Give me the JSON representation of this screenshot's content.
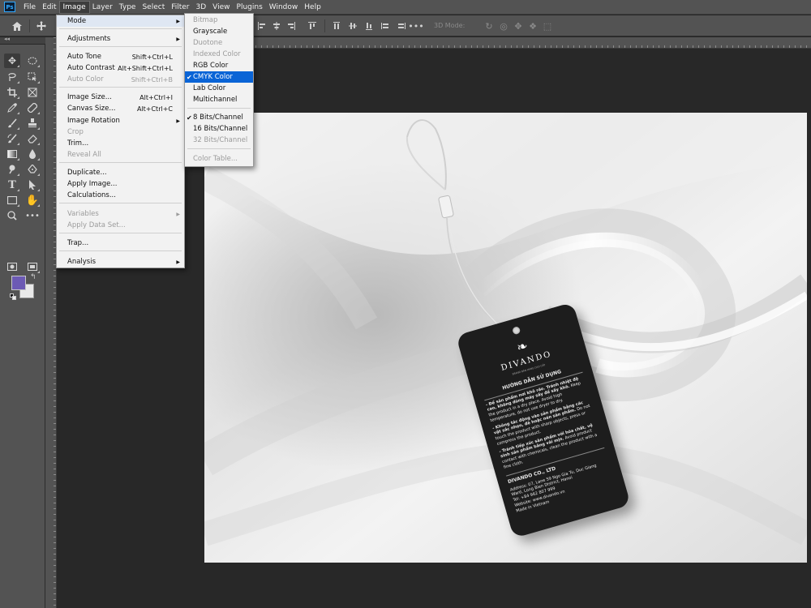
{
  "menubar": {
    "logo": "Ps",
    "items": [
      "File",
      "Edit",
      "Image",
      "Layer",
      "Type",
      "Select",
      "Filter",
      "3D",
      "View",
      "Plugins",
      "Window",
      "Help"
    ],
    "active": "Image"
  },
  "options_bar": {
    "mode_3d_label": "3D Mode:"
  },
  "image_menu": {
    "items": [
      {
        "label": "Mode",
        "shortcut": "",
        "submenu": true,
        "disabled": false
      },
      {
        "label": "Adjustments",
        "shortcut": "",
        "submenu": true,
        "disabled": false
      },
      {
        "label": "Auto Tone",
        "shortcut": "Shift+Ctrl+L",
        "submenu": false,
        "disabled": false
      },
      {
        "label": "Auto Contrast",
        "shortcut": "Alt+Shift+Ctrl+L",
        "submenu": false,
        "disabled": false
      },
      {
        "label": "Auto Color",
        "shortcut": "Shift+Ctrl+B",
        "submenu": false,
        "disabled": true
      },
      {
        "label": "Image Size...",
        "shortcut": "Alt+Ctrl+I",
        "submenu": false,
        "disabled": false
      },
      {
        "label": "Canvas Size...",
        "shortcut": "Alt+Ctrl+C",
        "submenu": false,
        "disabled": false
      },
      {
        "label": "Image Rotation",
        "shortcut": "",
        "submenu": true,
        "disabled": false
      },
      {
        "label": "Crop",
        "shortcut": "",
        "submenu": false,
        "disabled": true
      },
      {
        "label": "Trim...",
        "shortcut": "",
        "submenu": false,
        "disabled": false
      },
      {
        "label": "Reveal All",
        "shortcut": "",
        "submenu": false,
        "disabled": true
      },
      {
        "label": "Duplicate...",
        "shortcut": "",
        "submenu": false,
        "disabled": false
      },
      {
        "label": "Apply Image...",
        "shortcut": "",
        "submenu": false,
        "disabled": false
      },
      {
        "label": "Calculations...",
        "shortcut": "",
        "submenu": false,
        "disabled": false
      },
      {
        "label": "Variables",
        "shortcut": "",
        "submenu": true,
        "disabled": true
      },
      {
        "label": "Apply Data Set...",
        "shortcut": "",
        "submenu": false,
        "disabled": true
      },
      {
        "label": "Trap...",
        "shortcut": "",
        "submenu": false,
        "disabled": false
      },
      {
        "label": "Analysis",
        "shortcut": "",
        "submenu": true,
        "disabled": false
      }
    ]
  },
  "mode_menu": {
    "items": [
      {
        "label": "Bitmap",
        "disabled": true,
        "checked": false,
        "selected": false
      },
      {
        "label": "Grayscale",
        "disabled": false,
        "checked": false,
        "selected": false
      },
      {
        "label": "Duotone",
        "disabled": true,
        "checked": false,
        "selected": false
      },
      {
        "label": "Indexed Color",
        "disabled": true,
        "checked": false,
        "selected": false
      },
      {
        "label": "RGB Color",
        "disabled": false,
        "checked": false,
        "selected": false
      },
      {
        "label": "CMYK Color",
        "disabled": false,
        "checked": true,
        "selected": true
      },
      {
        "label": "Lab Color",
        "disabled": false,
        "checked": false,
        "selected": false
      },
      {
        "label": "Multichannel",
        "disabled": false,
        "checked": false,
        "selected": false
      },
      {
        "label": "8 Bits/Channel",
        "disabled": false,
        "checked": true,
        "selected": false
      },
      {
        "label": "16 Bits/Channel",
        "disabled": false,
        "checked": false,
        "selected": false
      },
      {
        "label": "32 Bits/Channel",
        "disabled": true,
        "checked": false,
        "selected": false
      },
      {
        "label": "Color Table...",
        "disabled": true,
        "checked": false,
        "selected": false
      }
    ]
  },
  "colors": {
    "foreground": "#6c5ab4",
    "background": "#e9e9e9",
    "menu_highlight": "#0a64d6"
  },
  "hang_tag": {
    "brand": "DIVANDO",
    "tagline": "BRAND BÁN HÀNG CAO CẤP",
    "heading": "HƯỚNG DẪN SỬ DỤNG",
    "instructions": [
      {
        "vi": "- Để sản phẩm nơi khô ráo. Tránh nhiệt độ cao, không dùng máy sấy để sấy khô.",
        "en": "Keep the product in a dry place. Avoid high temperature, do not use dryer to dry."
      },
      {
        "vi": "- Không tác động vào sản phẩm bằng các vật sắc nhọn, đè hoặc nén sản phẩm.",
        "en": "Do not touch the product with sharp objects, press or compress the product."
      },
      {
        "vi": "- Tránh tiếp xúc sản phẩm với hóa chất, vệ sinh sản phẩm bằng vải mịn.",
        "en": "Avoid product contact with chemicals, clean the product with a fine cloth."
      }
    ],
    "company": "DIVANDO CO., LTD",
    "address": "Address: 07, Lane 59 Ngo Gia Tu, Duc Giang Ward, Long Bien District, Hanoi",
    "tel": "Tel: +84 962 807 999",
    "website": "Website: www.divando.vn",
    "made_in": "Made in Vietnam"
  }
}
